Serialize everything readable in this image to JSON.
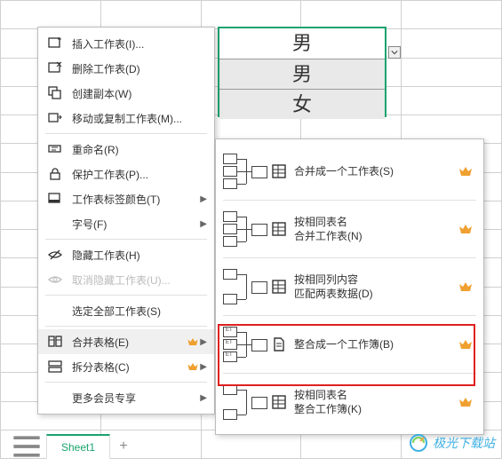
{
  "selection": {
    "values": [
      "男",
      "男",
      "女"
    ]
  },
  "menu": {
    "insert_sheet": "插入工作表(I)...",
    "delete_sheet": "删除工作表(D)",
    "create_copy": "创建副本(W)",
    "move_copy": "移动或复制工作表(M)...",
    "rename": "重命名(R)",
    "protect": "保护工作表(P)...",
    "tab_color": "工作表标签颜色(T)",
    "font_size": "字号(F)",
    "hide_sheet": "隐藏工作表(H)",
    "unhide_sheet": "取消隐藏工作表(U)...",
    "select_all": "选定全部工作表(S)",
    "merge_tables": "合并表格(E)",
    "split_tables": "拆分表格(C)",
    "more_member": "更多会员专享"
  },
  "submenu": {
    "merge_one_sheet": "合并成一个工作表(S)",
    "same_name_1": "按相同表名",
    "same_name_2": "合并工作表(N)",
    "same_col_1": "按相同列内容",
    "same_col_2": "匹配两表数据(D)",
    "merge_one_book": "整合成一个工作簿(B)",
    "same_name_b1": "按相同表名",
    "same_name_b2": "整合工作簿(K)"
  },
  "tabs": {
    "sheet1": "Sheet1",
    "add": "+"
  },
  "watermark": "极光下载站"
}
